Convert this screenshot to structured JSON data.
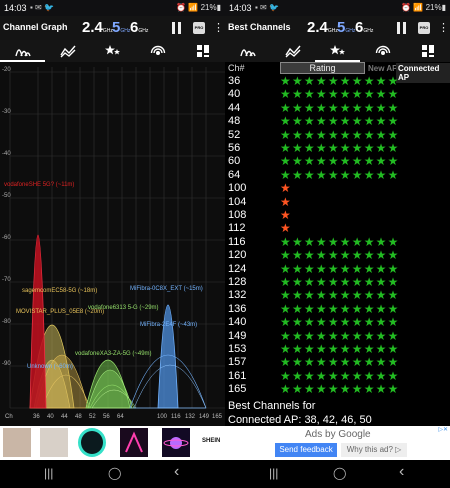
{
  "left_status": {
    "time": "14:03",
    "notif_icons": "▪ ✉ 🐦",
    "right_icons": "⏰ 📶 21%▮"
  },
  "right_status": {
    "time": "14:03",
    "notif_icons": "▪ ✉ 🐦",
    "right_icons": "⏰ 📶 21%▮"
  },
  "left_toolbar": {
    "title": "Channel Graph"
  },
  "right_toolbar": {
    "title": "Best Channels"
  },
  "bands": {
    "b24": "2.4",
    "b5": "5",
    "b6": "6",
    "unit": "GHz"
  },
  "pro_label": "PRO",
  "tab_icons": [
    "channel-graph-icon",
    "time-graph-icon",
    "channel-rating-icon",
    "ap-list-icon",
    "dashboard-icon"
  ],
  "graph": {
    "y_ticks": [
      "-20",
      "-30",
      "-40",
      "-50",
      "-60",
      "-70",
      "-80",
      "-90"
    ],
    "x_ticks": [
      "Ch",
      "36",
      "40",
      "44",
      "48",
      "52",
      "56",
      "64",
      "100",
      "116",
      "132",
      "149",
      "165"
    ],
    "network_labels": [
      {
        "text": "vodafoneSHE 5G? (~11m)",
        "color": "#dd2222"
      },
      {
        "text": "sagemcomEC58-5G (~18m)",
        "color": "#e8c35a"
      },
      {
        "text": "MiFibra-0C8X_EXT (~15m)",
        "color": "#74b4ff"
      },
      {
        "text": "MOVISTAR_PLUS_05E8 (~20m)",
        "color": "#e8c35a"
      },
      {
        "text": "vodafone6313 5-G (~29m)",
        "color": "#95e06b"
      },
      {
        "text": "MiFibra-2E4F (~43m)",
        "color": "#74b4ff"
      },
      {
        "text": "vodafoneXA3-ZA-5G (~49m)",
        "color": "#95e06b"
      },
      {
        "text": "Unknown (~60m)",
        "color": "#74b4ff"
      }
    ]
  },
  "rating": {
    "ch_title": "Ch#",
    "rating_label": "Rating",
    "new_ap": "New AP",
    "connected_ap": "Connected AP",
    "rows": [
      {
        "ch": "36",
        "stars": 10,
        "color": "#22bb22"
      },
      {
        "ch": "40",
        "stars": 10,
        "color": "#22bb22"
      },
      {
        "ch": "44",
        "stars": 10,
        "color": "#22bb22"
      },
      {
        "ch": "48",
        "stars": 10,
        "color": "#22bb22"
      },
      {
        "ch": "52",
        "stars": 10,
        "color": "#22bb22"
      },
      {
        "ch": "56",
        "stars": 10,
        "color": "#22bb22"
      },
      {
        "ch": "60",
        "stars": 10,
        "color": "#22bb22"
      },
      {
        "ch": "64",
        "stars": 10,
        "color": "#22bb22"
      },
      {
        "ch": "100",
        "stars": 1,
        "color": "#ff5522"
      },
      {
        "ch": "104",
        "stars": 1,
        "color": "#ff5522"
      },
      {
        "ch": "108",
        "stars": 1,
        "color": "#ff5522"
      },
      {
        "ch": "112",
        "stars": 1,
        "color": "#ff5522"
      },
      {
        "ch": "116",
        "stars": 10,
        "color": "#22bb22"
      },
      {
        "ch": "120",
        "stars": 10,
        "color": "#22bb22"
      },
      {
        "ch": "124",
        "stars": 10,
        "color": "#22bb22"
      },
      {
        "ch": "128",
        "stars": 10,
        "color": "#22bb22"
      },
      {
        "ch": "132",
        "stars": 10,
        "color": "#22bb22"
      },
      {
        "ch": "136",
        "stars": 10,
        "color": "#22bb22"
      },
      {
        "ch": "140",
        "stars": 10,
        "color": "#22bb22"
      },
      {
        "ch": "149",
        "stars": 10,
        "color": "#22bb22"
      },
      {
        "ch": "153",
        "stars": 10,
        "color": "#22bb22"
      },
      {
        "ch": "157",
        "stars": 10,
        "color": "#22bb22"
      },
      {
        "ch": "161",
        "stars": 10,
        "color": "#22bb22"
      },
      {
        "ch": "165",
        "stars": 10,
        "color": "#22bb22"
      }
    ],
    "best_line1": "Best Channels for",
    "best_line2": "Connected AP: 38, 42, 46, 50"
  },
  "ad": {
    "ads_by": "Ads by Google",
    "feedback": "Send feedback",
    "why": "Why this ad? ▷",
    "shein": "SHEIN",
    "info": "▷✕"
  },
  "nav": {
    "recents": "|||",
    "home": "◯",
    "back": "‹"
  }
}
